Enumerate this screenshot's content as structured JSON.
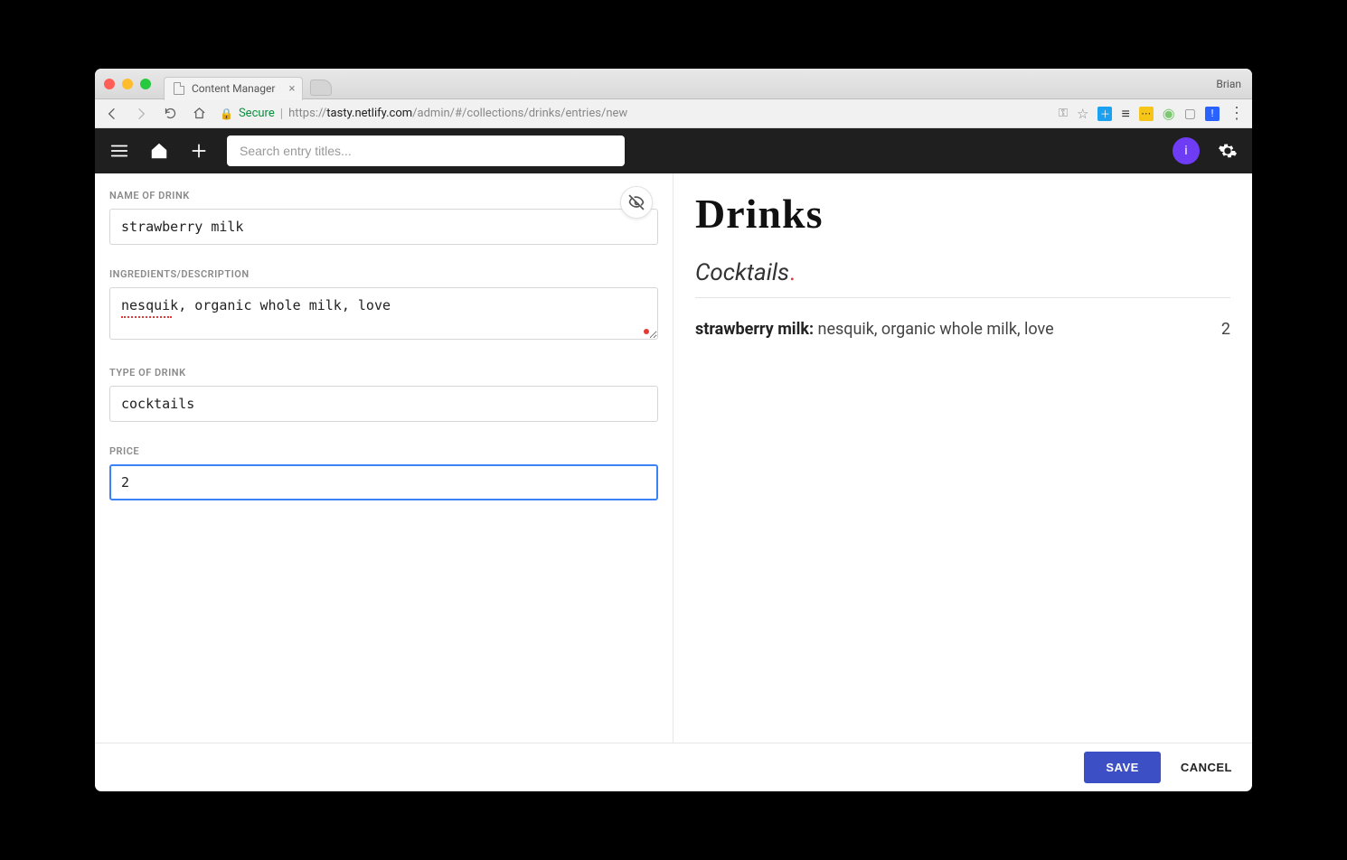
{
  "browser": {
    "tab_title": "Content Manager",
    "user": "Brian",
    "secure_label": "Secure",
    "url_host": "tasty.netlify.com",
    "url_path": "/admin/#/collections/drinks/entries/new",
    "url_prefix": "https://"
  },
  "header": {
    "search_placeholder": "Search entry titles...",
    "avatar_initial": "i"
  },
  "form": {
    "fields": {
      "name": {
        "label": "NAME OF DRINK",
        "value": "strawberry milk"
      },
      "ingredients": {
        "label": "INGREDIENTS/DESCRIPTION",
        "value": "nesquik, organic whole milk, love"
      },
      "type": {
        "label": "TYPE OF DRINK",
        "value": "cocktails"
      },
      "price": {
        "label": "PRICE",
        "value": "2"
      }
    }
  },
  "preview": {
    "heading": "Drinks",
    "category": "Cocktails",
    "item_name": "strawberry milk:",
    "item_desc": "nesquik, organic whole milk, love",
    "item_price": "2"
  },
  "footer": {
    "save": "SAVE",
    "cancel": "CANCEL"
  }
}
